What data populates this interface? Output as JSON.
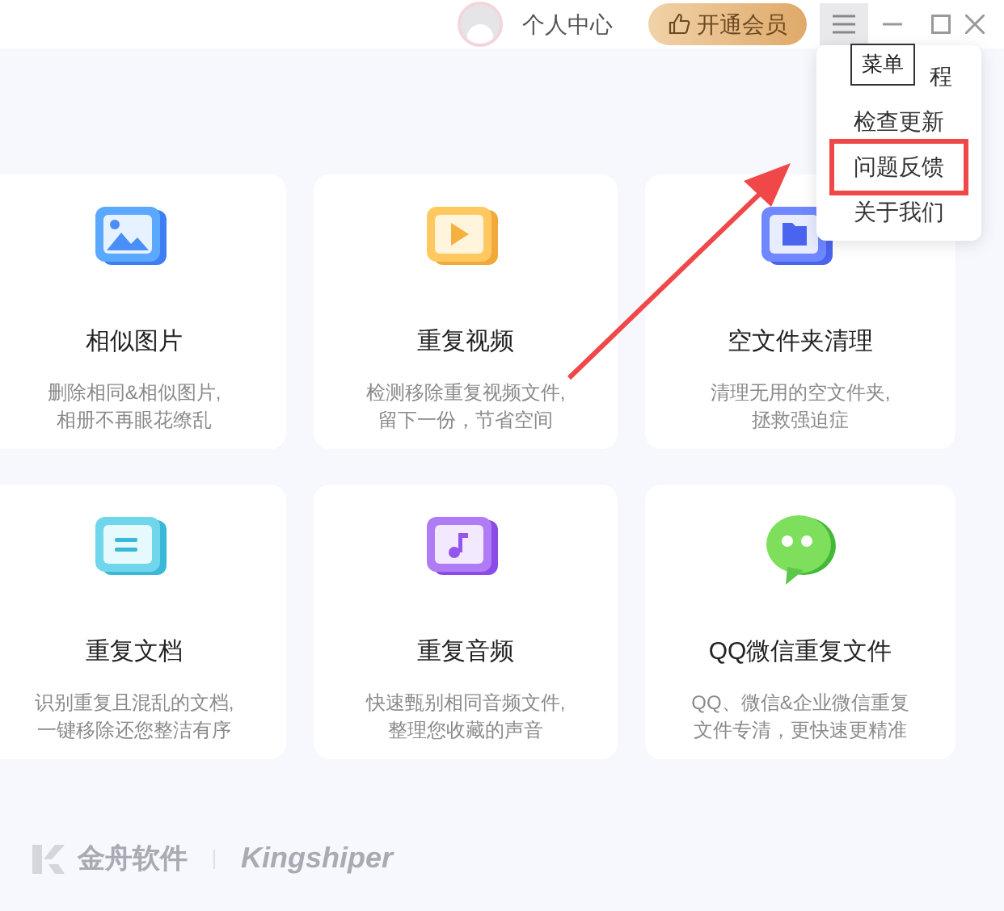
{
  "top_bar": {
    "user_label": "个人中心",
    "vip_button": "开通会员"
  },
  "menu": {
    "tooltip": "菜单",
    "items": [
      {
        "label": "程",
        "highlighted": false
      },
      {
        "label": "检查更新",
        "highlighted": false
      },
      {
        "label": "问题反馈",
        "highlighted": true
      },
      {
        "label": "关于我们",
        "highlighted": false
      }
    ]
  },
  "cards": [
    {
      "kind": "image",
      "title": "相似图片",
      "lines": [
        "删除相同&相似图片,",
        "相册不再眼花缭乱"
      ]
    },
    {
      "kind": "video",
      "title": "重复视频",
      "lines": [
        "检测移除重复视频文件,",
        "留下一份，节省空间"
      ]
    },
    {
      "kind": "folder",
      "title": "空文件夹清理",
      "lines": [
        "清理无用的空文件夹,",
        "拯救强迫症"
      ]
    },
    {
      "kind": "document",
      "title": "重复文档",
      "lines": [
        "识别重复且混乱的文档,",
        "一键移除还您整洁有序"
      ]
    },
    {
      "kind": "audio",
      "title": "重复音频",
      "lines": [
        "快速甄别相同音频文件,",
        "整理您收藏的声音"
      ]
    },
    {
      "kind": "chat",
      "title": "QQ微信重复文件",
      "lines": [
        "QQ、微信&企业微信重复",
        "文件专清，更快速更精准"
      ]
    }
  ],
  "footer": {
    "brand_cn": "金舟软件",
    "brand_en": "Kingshiper"
  }
}
